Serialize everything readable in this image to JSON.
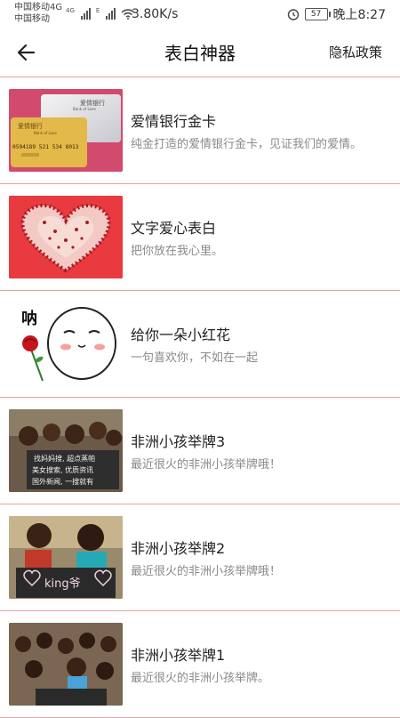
{
  "status_bar": {
    "carrier_1": "中国移动4G",
    "carrier_2": "中国移动",
    "net_1": "4G",
    "net_2": "E",
    "speed": "3.80K/s",
    "battery": "57",
    "time": "晚上8:27"
  },
  "header": {
    "title": "表白神器",
    "right_link": "隐私政策"
  },
  "items": [
    {
      "title": "爱情银行金卡",
      "desc": "纯金打造的爱情银行金卡，见证我们的爱情。",
      "image_text_1": "爱情银行",
      "image_text_2": "Bank of Love",
      "image_text_3": "0594189 521 534 8013"
    },
    {
      "title": "文字爱心表白",
      "desc": "把你放在我心里。"
    },
    {
      "title": "给你一朵小红花",
      "desc": "一句喜欢你，不如在一起",
      "image_text_1": "呐"
    },
    {
      "title": "非洲小孩举牌3",
      "desc": "最近很火的非洲小孩举牌哦！",
      "image_text_1": "找妈妈搜, 超点蒸帕",
      "image_text_2": "美女搜索, 优质资讯",
      "image_text_3": "国外新闻, 一搜就有"
    },
    {
      "title": "非洲小孩举牌2",
      "desc": "最近很火的非洲小孩举牌哦！",
      "image_text_1": "king爷"
    },
    {
      "title": "非洲小孩举牌1",
      "desc": "最近很火的非洲小孩举牌。"
    }
  ],
  "colors": {
    "divider": "#e6a0a0",
    "accent": "#d9202e"
  }
}
